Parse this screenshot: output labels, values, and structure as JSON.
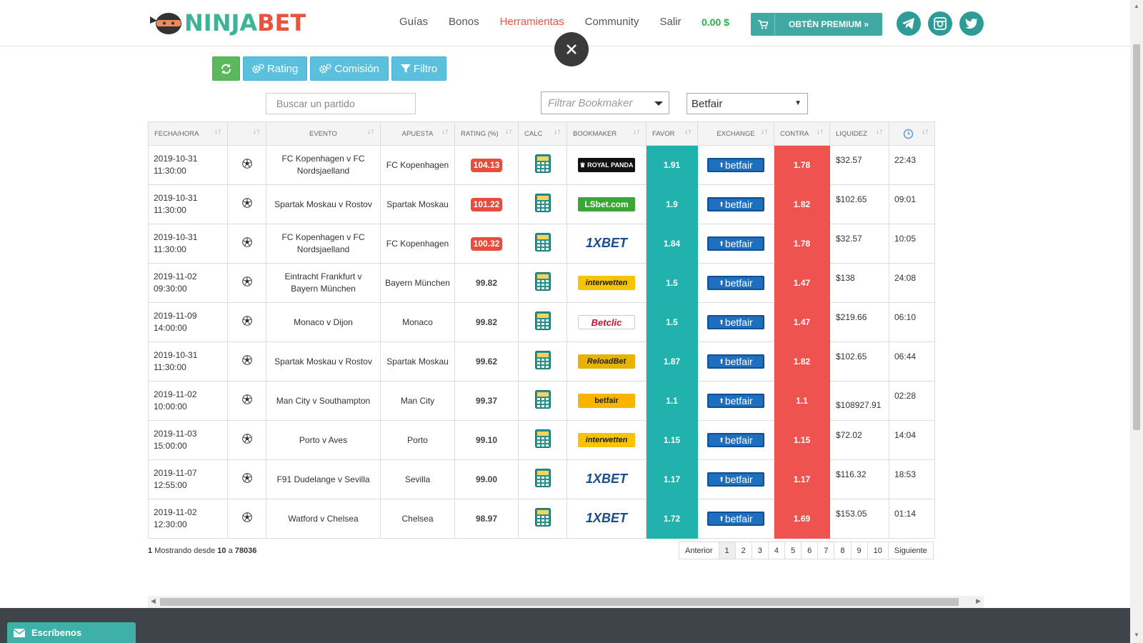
{
  "brand": {
    "part1": "NINJA",
    "part2": "BET"
  },
  "nav": [
    "Guías",
    "Bonos",
    "Herramientas",
    "Community",
    "Salir"
  ],
  "nav_active": "Herramientas",
  "balance": "0.00 $",
  "premium_label": "OBTÉN PREMIUM »",
  "toolbar": {
    "rating": "Rating",
    "comision": "Comisión",
    "filtro": "Filtro"
  },
  "search": {
    "placeholder": "Buscar un partido"
  },
  "bookmaker_filter": {
    "placeholder": "Filtrar Bookmaker"
  },
  "exchange_select": {
    "value": "Betfair"
  },
  "table": {
    "headers": [
      "FECHA/HORA",
      "",
      "EVENTO",
      "APUESTA",
      "RATING (%)",
      "CALC",
      "BOOKMAKER",
      "FAVOR",
      "EXCHANGE",
      "CONTRA",
      "LIQUIDEZ",
      ""
    ],
    "rows": [
      {
        "date": "2019-10-31",
        "time": "11:30:00",
        "event": "FC Kopenhagen v FC Nordsjaelland",
        "bet": "FC Kopenhagen",
        "rating": "104.13",
        "highlight": true,
        "bookmaker": "Royal Panda",
        "favor": "1.91",
        "exchange": "betfair",
        "contra": "1.78",
        "liquidity": "$32.57",
        "updated": "22:43"
      },
      {
        "date": "2019-10-31",
        "time": "11:30:00",
        "event": "Spartak Moskau v Rostov",
        "bet": "Spartak Moskau",
        "rating": "101.22",
        "highlight": true,
        "bookmaker": "LSbet.com",
        "favor": "1.9",
        "exchange": "betfair",
        "contra": "1.82",
        "liquidity": "$102.65",
        "updated": "09:01"
      },
      {
        "date": "2019-10-31",
        "time": "11:30:00",
        "event": "FC Kopenhagen v FC Nordsjaelland",
        "bet": "FC Kopenhagen",
        "rating": "100.32",
        "highlight": true,
        "bookmaker": "1XBET",
        "favor": "1.84",
        "exchange": "betfair",
        "contra": "1.78",
        "liquidity": "$32.57",
        "updated": "10:05"
      },
      {
        "date": "2019-11-02",
        "time": "09:30:00",
        "event": "Eintracht Frankfurt v Bayern München",
        "bet": "Bayern München",
        "rating": "99.82",
        "highlight": false,
        "bookmaker": "interwetten",
        "favor": "1.5",
        "exchange": "betfair",
        "contra": "1.47",
        "liquidity": "$138",
        "updated": "24:08"
      },
      {
        "date": "2019-11-09",
        "time": "14:00:00",
        "event": "Monaco v Dijon",
        "bet": "Monaco",
        "rating": "99.82",
        "highlight": false,
        "bookmaker": "Betclic",
        "favor": "1.5",
        "exchange": "betfair",
        "contra": "1.47",
        "liquidity": "$219.66",
        "updated": "06:10"
      },
      {
        "date": "2019-10-31",
        "time": "11:30:00",
        "event": "Spartak Moskau v Rostov",
        "bet": "Spartak Moskau",
        "rating": "99.62",
        "highlight": false,
        "bookmaker": "ReloadBet",
        "favor": "1.87",
        "exchange": "betfair",
        "contra": "1.82",
        "liquidity": "$102.65",
        "updated": "06:44"
      },
      {
        "date": "2019-11-02",
        "time": "10:00:00",
        "event": "Man City v Southampton",
        "bet": "Man City",
        "rating": "99.37",
        "highlight": false,
        "bookmaker": "betfair SPORTSBOOK",
        "favor": "1.1",
        "exchange": "betfair",
        "contra": "1.1",
        "liquidity": "$108927.91",
        "updated": "02:28"
      },
      {
        "date": "2019-11-03",
        "time": "15:00:00",
        "event": "Porto v Aves",
        "bet": "Porto",
        "rating": "99.10",
        "highlight": false,
        "bookmaker": "interwetten",
        "favor": "1.15",
        "exchange": "betfair",
        "contra": "1.15",
        "liquidity": "$72.02",
        "updated": "14:04"
      },
      {
        "date": "2019-11-07",
        "time": "12:55:00",
        "event": "F91 Dudelange v Sevilla",
        "bet": "Sevilla",
        "rating": "99.00",
        "highlight": false,
        "bookmaker": "1XBET",
        "favor": "1.17",
        "exchange": "betfair",
        "contra": "1.17",
        "liquidity": "$116.32",
        "updated": "18:53"
      },
      {
        "date": "2019-11-02",
        "time": "12:30:00",
        "event": "Watford v Chelsea",
        "bet": "Chelsea",
        "rating": "98.97",
        "highlight": false,
        "bookmaker": "1XBET",
        "favor": "1.72",
        "exchange": "betfair",
        "contra": "1.69",
        "liquidity": "$153.05",
        "updated": "01:14"
      }
    ]
  },
  "footer_info": {
    "n": "1",
    "text1": "Mostrando desde",
    "from": "10",
    "text2": "a",
    "to": "78036"
  },
  "pager": [
    "Anterior",
    "1",
    "2",
    "3",
    "4",
    "5",
    "6",
    "7",
    "8",
    "9",
    "10",
    "Siguiente"
  ],
  "contact_label": "Escríbenos",
  "colors": {
    "favor": "#22b2ad",
    "contra": "#ef5350",
    "brand_green": "#3fb39a",
    "brand_red": "#e8543e",
    "accent": "#5bc0de"
  }
}
